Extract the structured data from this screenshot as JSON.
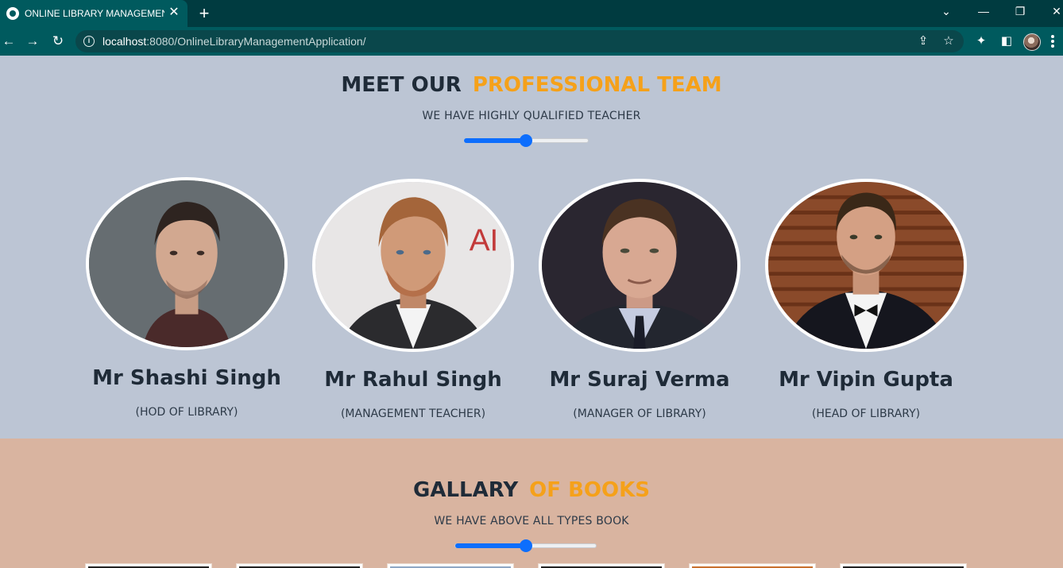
{
  "browser": {
    "tab_title": "ONLINE LIBRARY MANAGEMENT",
    "url_host": "localhost",
    "url_rest": ":8080/OnlineLibraryManagementApplication/"
  },
  "team": {
    "title_main": "MEET OUR",
    "title_accent": "PROFESSIONAL TEAM",
    "subtitle": "WE HAVE HIGHLY QUALIFIED TEACHER",
    "slider_value_percent": 50,
    "members": [
      {
        "name": "Mr Shashi Singh",
        "role": "(HOD OF LIBRARY)"
      },
      {
        "name": "Mr Rahul Singh",
        "role": "(MANAGEMENT TEACHER)"
      },
      {
        "name": "Mr Suraj Verma",
        "role": "(MANAGER OF LIBRARY)"
      },
      {
        "name": "Mr Vipin Gupta",
        "role": "(HEAD OF LIBRARY)"
      }
    ]
  },
  "gallery": {
    "title_main": "GALLARY",
    "title_accent": "OF BOOKS",
    "subtitle": "WE HAVE ABOVE ALL TYPES BOOK",
    "slider_value_percent": 50
  },
  "colors": {
    "accent": "#f5a11a",
    "team_bg": "#bcc5d4",
    "gallery_bg": "#d9b4a0",
    "slider": "#0d6efd",
    "chrome": "#005a5e"
  },
  "icons": [
    "globe-icon",
    "close-icon",
    "plus-icon",
    "back-icon",
    "forward-icon",
    "reload-icon",
    "info-icon",
    "share-icon",
    "star-icon",
    "puzzle-icon",
    "side-panel-icon",
    "profile-avatar",
    "menu-icon"
  ]
}
